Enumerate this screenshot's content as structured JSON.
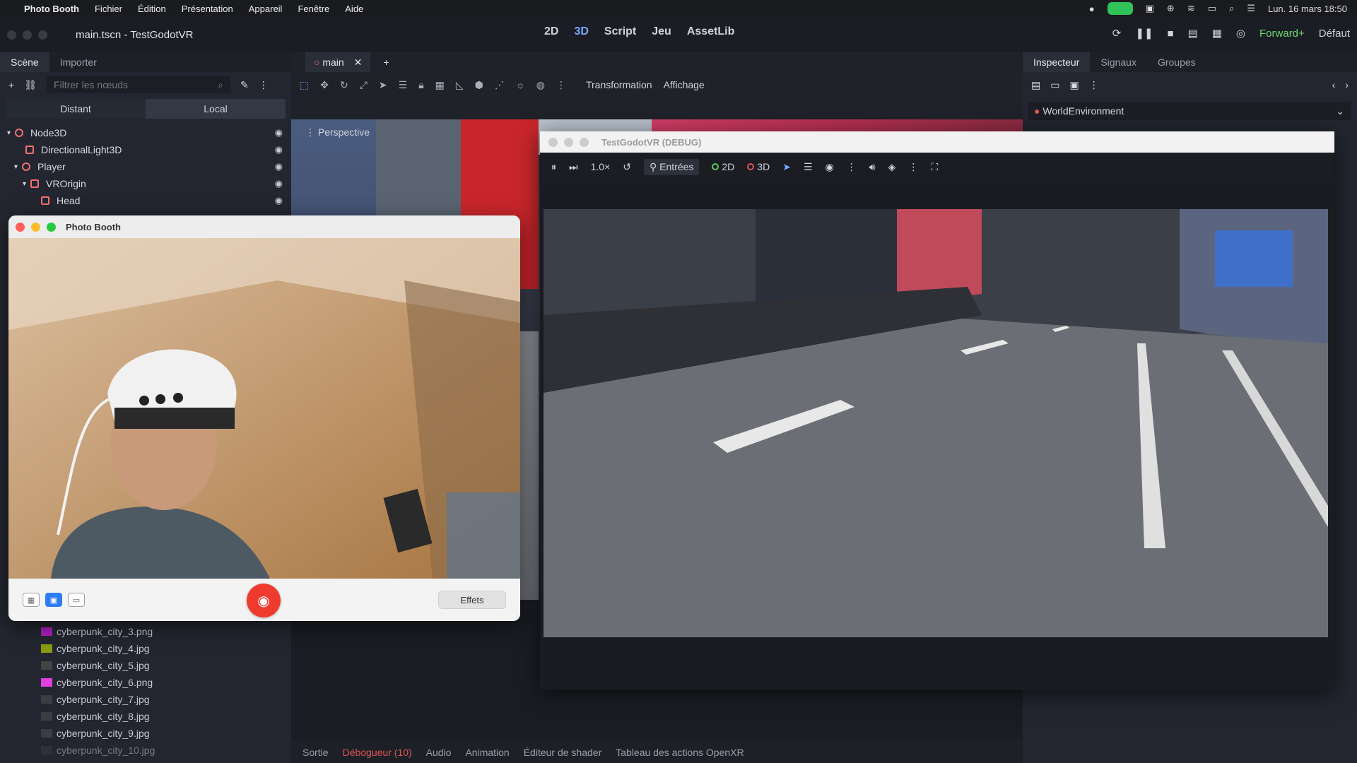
{
  "menubar": {
    "app": "Photo Booth",
    "items": [
      "Fichier",
      "Édition",
      "Présentation",
      "Appareil",
      "Fenêtre",
      "Aide"
    ],
    "clock": "Lun. 16 mars  18:50"
  },
  "godot": {
    "window_title": "main.tscn - TestGodotVR",
    "modes": [
      "2D",
      "3D",
      "Script",
      "Jeu",
      "AssetLib"
    ],
    "renderer": "Forward+",
    "layout": "Défaut",
    "left_dock": {
      "tabs": [
        "Scène",
        "Importer"
      ],
      "filter_placeholder": "Filtrer les nœuds",
      "remote_local": [
        "Distant",
        "Local"
      ],
      "tree": [
        "Node3D",
        "DirectionalLight3D",
        "Player",
        "VROrigin",
        "Head"
      ],
      "files": [
        "cyberpunk_city_3.png",
        "cyberpunk_city_4.jpg",
        "cyberpunk_city_5.jpg",
        "cyberpunk_city_6.png",
        "cyberpunk_city_7.jpg",
        "cyberpunk_city_8.jpg",
        "cyberpunk_city_9.jpg",
        "cyberpunk_city_10.jpg"
      ]
    },
    "scene_tab": "main",
    "viewport_toolbar": {
      "transform": "Transformation",
      "view": "Affichage",
      "perspective": "Perspective"
    },
    "bottom_tabs": [
      "Sortie",
      "Débogueur (10)",
      "Audio",
      "Animation",
      "Éditeur de shader",
      "Tableau des actions OpenXR"
    ],
    "right_dock": {
      "tabs": [
        "Inspecteur",
        "Signaux",
        "Groupes"
      ],
      "resource": "WorldEnvironment"
    }
  },
  "debug_window": {
    "title": "TestGodotVR (DEBUG)",
    "speed": "1.0×",
    "inputs": "Entrées",
    "mode2d": "2D",
    "mode3d": "3D"
  },
  "photobooth": {
    "title": "Photo Booth",
    "effects": "Effets"
  }
}
